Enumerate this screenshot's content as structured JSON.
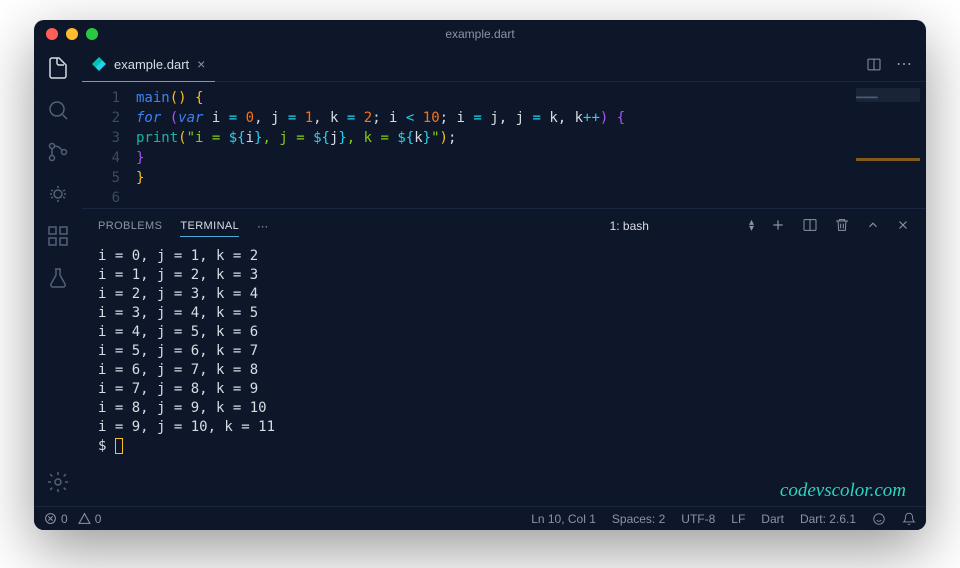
{
  "window": {
    "title": "example.dart"
  },
  "tab": {
    "filename": "example.dart"
  },
  "code": {
    "lines": [
      "1",
      "2",
      "3",
      "4",
      "5",
      "6"
    ],
    "l1_main": "main",
    "l2_for": "for",
    "l2_var": "var",
    "l2_i": "i",
    "l2_j": "j",
    "l2_k": "k",
    "l2_eq": "=",
    "l2_lt": "<",
    "l2_pp": "++",
    "l2_n0": "0",
    "l2_n1": "1",
    "l2_n2": "2",
    "l2_n10": "10",
    "l3_print": "print",
    "l3_str1": "\"i = ",
    "l3_str2": ", j = ",
    "l3_str3": ", k = ",
    "l3_str4": "\"",
    "l3_do": "${",
    "l3_dc": "}",
    "l3_i": "i",
    "l3_j": "j",
    "l3_k": "k"
  },
  "panel": {
    "tabs": {
      "problems": "PROBLEMS",
      "terminal": "TERMINAL"
    },
    "terminal_selector": "1: bash"
  },
  "terminal": {
    "lines": [
      "i = 0, j = 1, k = 2",
      "i = 1, j = 2, k = 3",
      "i = 2, j = 3, k = 4",
      "i = 3, j = 4, k = 5",
      "i = 4, j = 5, k = 6",
      "i = 5, j = 6, k = 7",
      "i = 6, j = 7, k = 8",
      "i = 7, j = 8, k = 9",
      "i = 8, j = 9, k = 10",
      "i = 9, j = 10, k = 11"
    ],
    "prompt": "$ "
  },
  "watermark": "codevscolor.com",
  "status": {
    "errors": "0",
    "warnings": "0",
    "cursor": "Ln 10, Col 1",
    "spaces": "Spaces: 2",
    "encoding": "UTF-8",
    "eol": "LF",
    "lang": "Dart",
    "sdk": "Dart: 2.6.1"
  }
}
